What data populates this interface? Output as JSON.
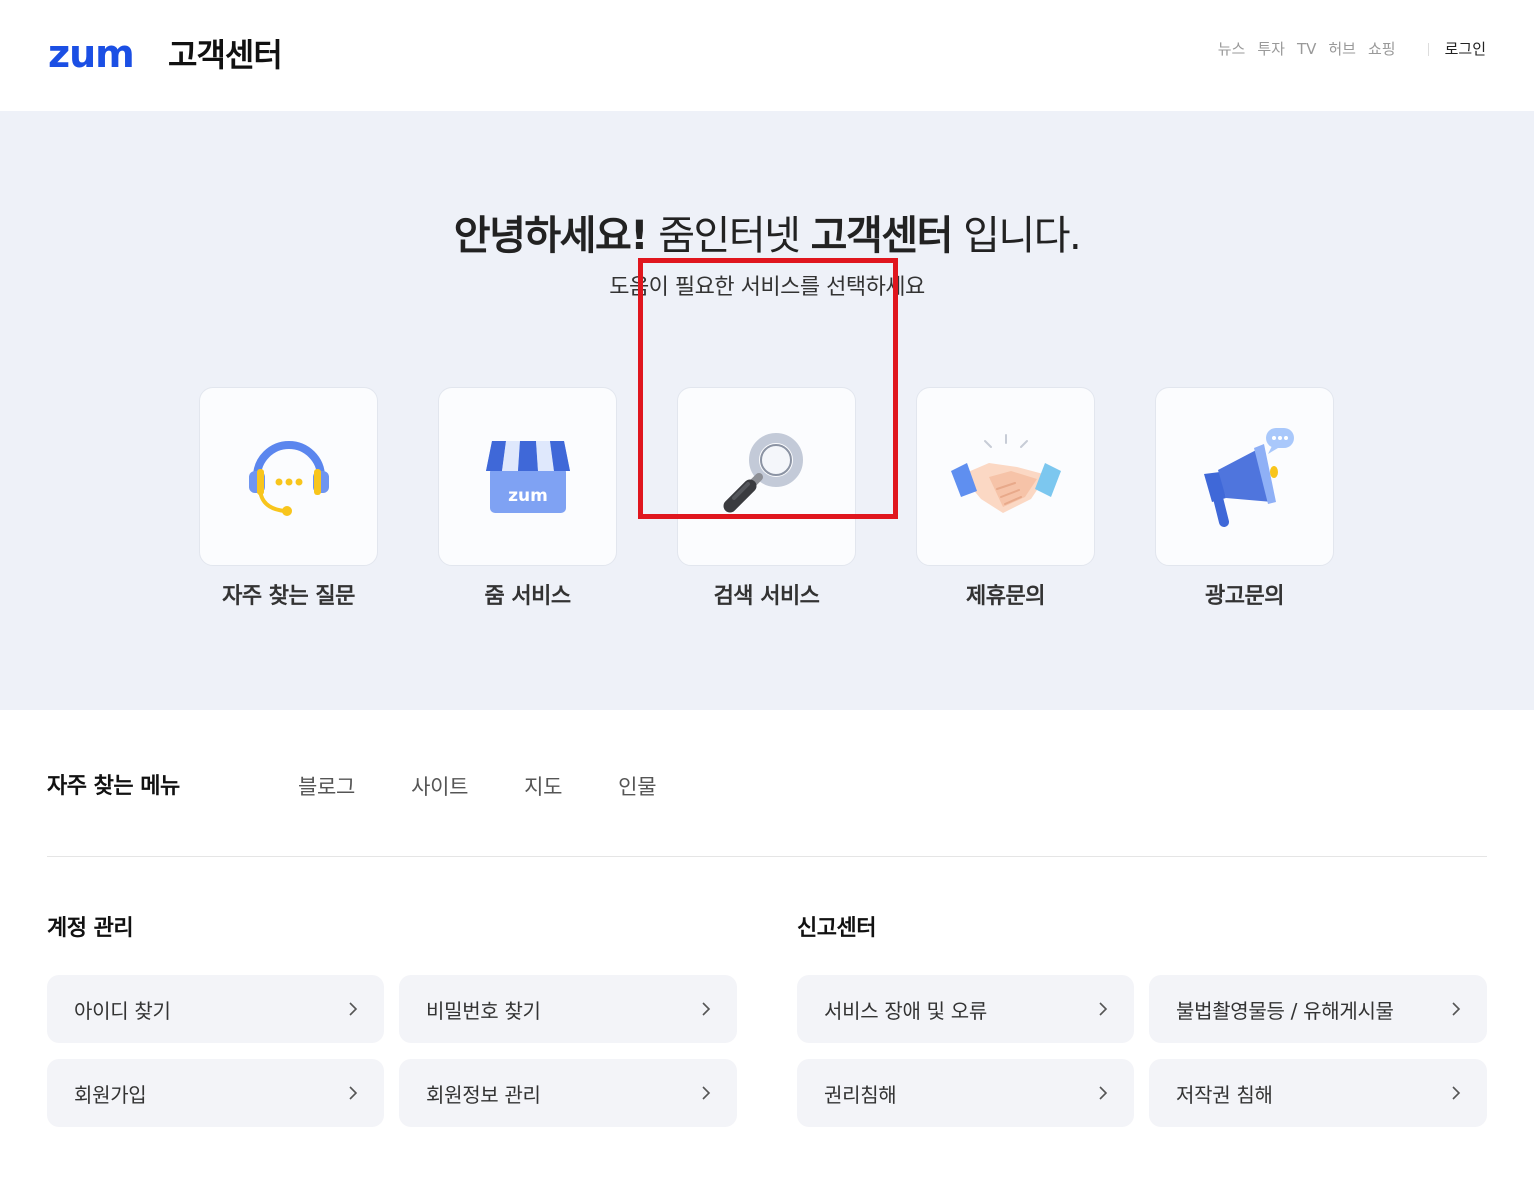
{
  "header": {
    "logo": "zum",
    "title": "고객센터",
    "nav": [
      "뉴스",
      "투자",
      "TV",
      "허브",
      "쇼핑"
    ],
    "login": "로그인"
  },
  "hero": {
    "title_bold1": "안녕하세요!",
    "title_light1": " 줌인터넷 ",
    "title_bold2": "고객센터",
    "title_light2": " 입니다.",
    "subtitle": "도움이 필요한 서비스를 선택하세요",
    "cards": [
      {
        "label": "자주 찾는 질문",
        "icon": "headset-icon"
      },
      {
        "label": "줌 서비스",
        "icon": "store-icon"
      },
      {
        "label": "검색 서비스",
        "icon": "magnifier-icon"
      },
      {
        "label": "제휴문의",
        "icon": "handshake-icon"
      },
      {
        "label": "광고문의",
        "icon": "megaphone-icon"
      }
    ],
    "store_icon_text": "zum"
  },
  "quick_menu": {
    "title": "자주 찾는 메뉴",
    "links": [
      "블로그",
      "사이트",
      "지도",
      "인물"
    ]
  },
  "account": {
    "title": "계정 관리",
    "items": [
      "아이디 찾기",
      "비밀번호 찾기",
      "회원가입",
      "회원정보 관리"
    ]
  },
  "report": {
    "title": "신고센터",
    "items": [
      "서비스 장애 및 오류",
      "불법촬영물등 / 유해게시물",
      "권리침해",
      "저작권 침해"
    ]
  },
  "colors": {
    "brand": "#1b4fe4",
    "hero_bg": "#eef1f8",
    "tile_bg": "#f3f4f8",
    "highlight": "#e0161e"
  }
}
